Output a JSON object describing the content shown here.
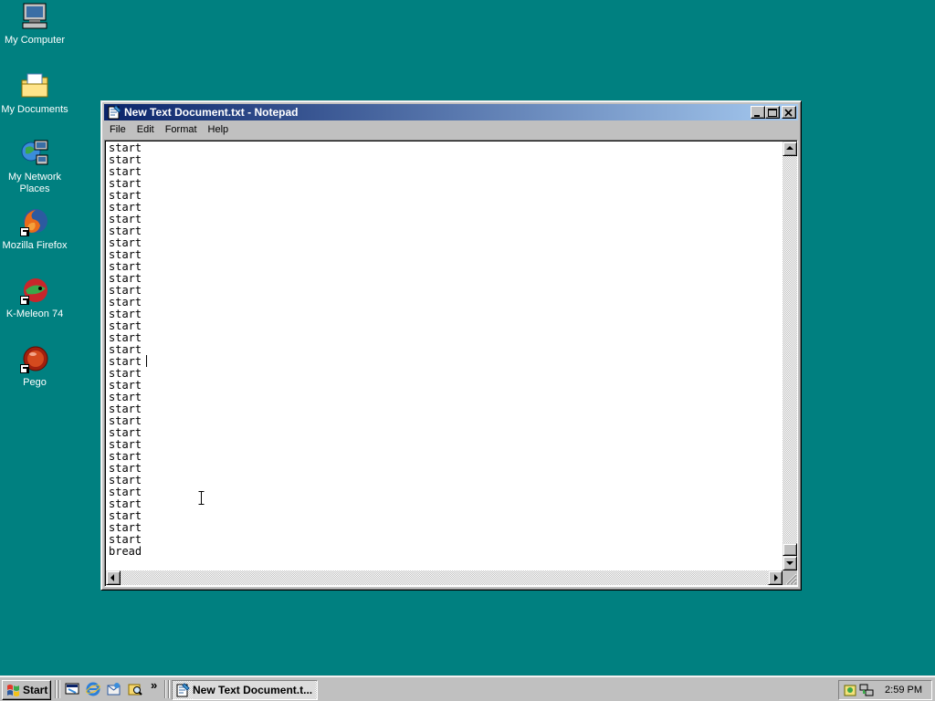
{
  "desktop": {
    "icons": [
      {
        "label": "My Computer",
        "icon": "computer-icon"
      },
      {
        "label": "My Documents",
        "icon": "documents-folder-icon"
      },
      {
        "label": "My Network Places",
        "icon": "network-places-icon"
      },
      {
        "label": "Mozilla Firefox",
        "icon": "firefox-icon"
      },
      {
        "label": "K-Meleon 74",
        "icon": "kmeleon-icon"
      },
      {
        "label": "Pego",
        "icon": "pego-icon"
      }
    ]
  },
  "window": {
    "title": "New Text Document.txt - Notepad",
    "menu": [
      "File",
      "Edit",
      "Format",
      "Help"
    ],
    "text": "start\nstart\nstart\nstart\nstart\nstart\nstart\nstart\nstart\nstart\nstart\nstart\nstart\nstart\nstart\nstart\nstart\nstart\nstart\nstart\nstart\nstart\nstart\nstart\nstart\nstart\nstart\nstart\nstart\nstart\nstart\nstart\nstart\nstart\nbread"
  },
  "taskbar": {
    "start_label": "Start",
    "quick_launch": [
      "show-desktop-icon",
      "ie-icon",
      "outlook-icon",
      "explorer-icon"
    ],
    "chevron": "»",
    "task_label": "New Text Document.t...",
    "clock": "2:59 PM"
  },
  "colors": {
    "desktop": "#008080",
    "titlebar_start": "#0a246a",
    "titlebar_end": "#a6caf0",
    "chrome": "#c0c0c0"
  }
}
